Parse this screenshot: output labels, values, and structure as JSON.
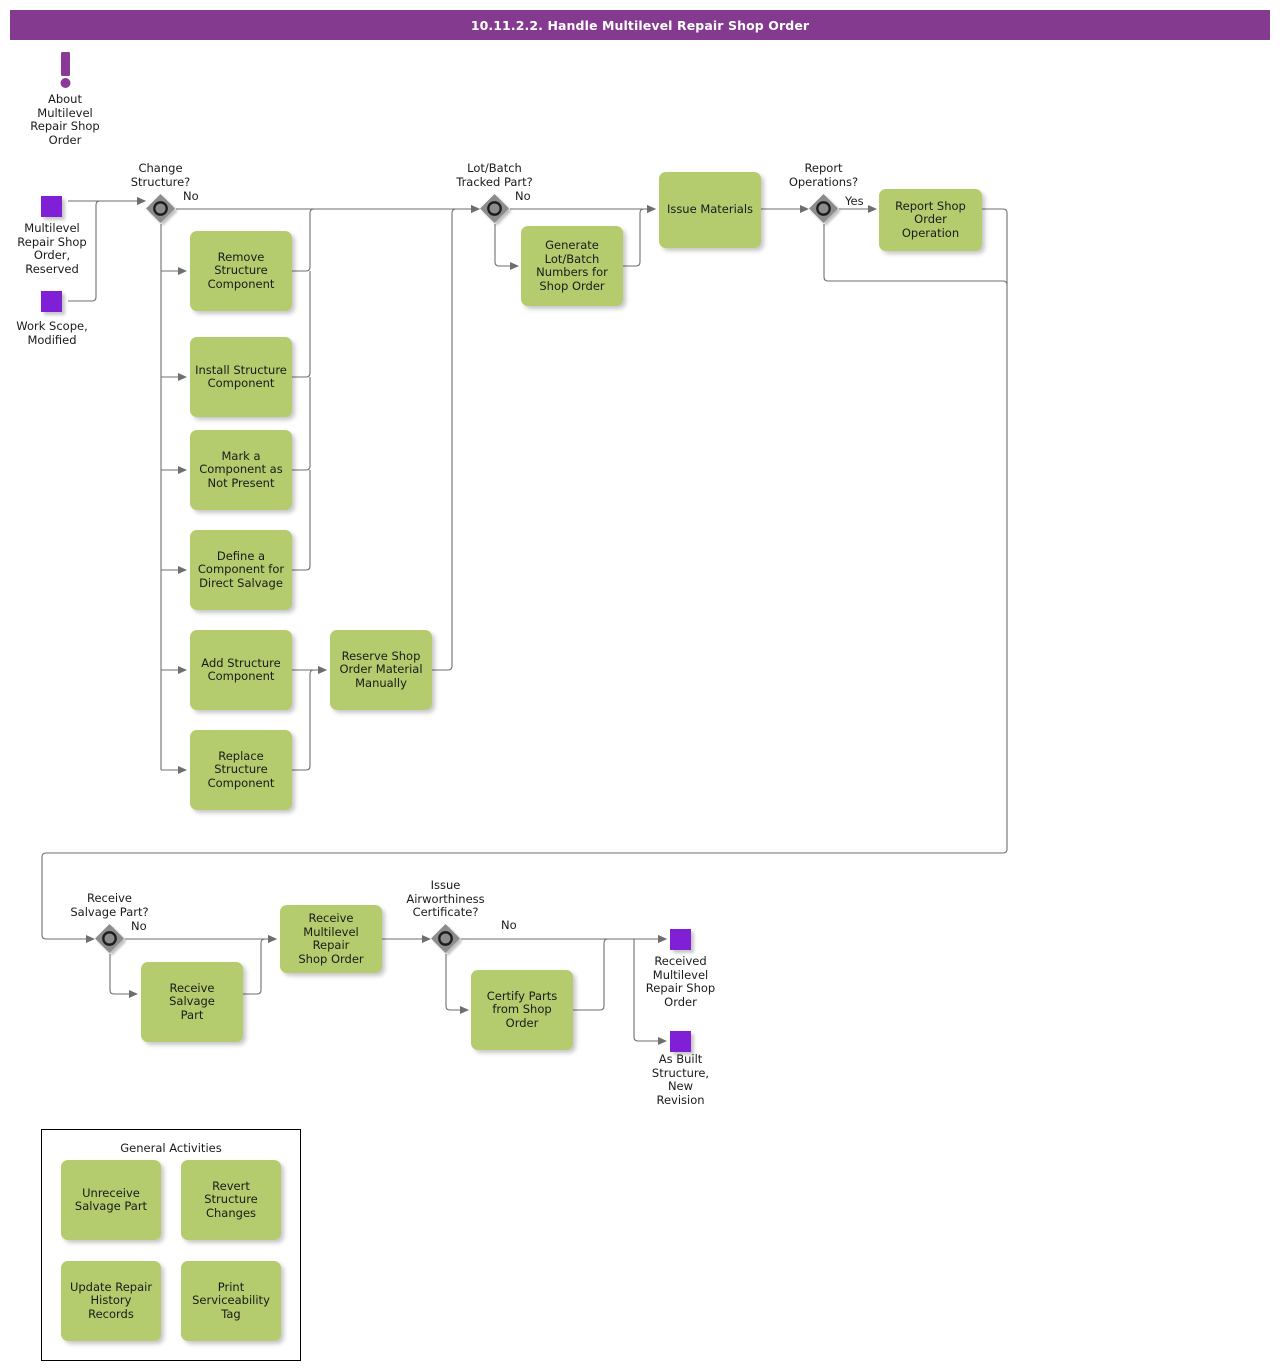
{
  "header": {
    "title": "10.11.2.2. Handle Multilevel Repair Shop Order"
  },
  "about": {
    "icon": "exclamation-mark-icon",
    "label": "About\nMultilevel\nRepair Shop\nOrder"
  },
  "start_nodes": [
    {
      "name": "multilevel-repair-shop-order-reserved",
      "label": "Multilevel\nRepair Shop\nOrder,\nReserved"
    },
    {
      "name": "work-scope-modified",
      "label": "Work Scope,\nModified"
    }
  ],
  "end_nodes": [
    {
      "name": "received-multilevel-repair-shop-order",
      "label": "Received\nMultilevel\nRepair Shop\nOrder"
    },
    {
      "name": "as-built-structure-new-revision",
      "label": "As Built\nStructure,\nNew\nRevision"
    }
  ],
  "gateways": [
    {
      "name": "change-structure",
      "label": "Change\nStructure?",
      "branch_label": "No"
    },
    {
      "name": "lot-batch-tracked-part",
      "label": "Lot/Batch\nTracked Part?",
      "branch_label": "No"
    },
    {
      "name": "report-operations",
      "label": "Report\nOperations?",
      "branch_label": "Yes"
    },
    {
      "name": "receive-salvage-part",
      "label": "Receive\nSalvage Part?",
      "branch_label": "No"
    },
    {
      "name": "issue-airworthiness-certificate",
      "label": "Issue\nAirworthiness\nCertificate?",
      "branch_label": "No"
    }
  ],
  "activities": [
    {
      "name": "remove-structure-component",
      "label": "Remove\nStructure\nComponent"
    },
    {
      "name": "install-structure-component",
      "label": "Install Structure\nComponent"
    },
    {
      "name": "mark-a-component-as-not-present",
      "label": "Mark a\nComponent as\nNot Present"
    },
    {
      "name": "define-a-component-for-direct-salvage",
      "label": "Define a\nComponent for\nDirect Salvage"
    },
    {
      "name": "add-structure-component",
      "label": "Add Structure\nComponent"
    },
    {
      "name": "replace-structure-component",
      "label": "Replace\nStructure\nComponent"
    },
    {
      "name": "reserve-shop-order-material-manually",
      "label": "Reserve Shop\nOrder Material\nManually"
    },
    {
      "name": "generate-lot-batch-numbers-for-shop-order",
      "label": "Generate\nLot/Batch\nNumbers for\nShop Order"
    },
    {
      "name": "issue-materials",
      "label": "Issue Materials"
    },
    {
      "name": "report-shop-order-operation",
      "label": "Report Shop\nOrder Operation"
    },
    {
      "name": "receive-salvage-part",
      "label": "Receive Salvage\nPart"
    },
    {
      "name": "receive-multilevel-repair-shop-order",
      "label": "Receive\nMultilevel Repair\nShop Order"
    },
    {
      "name": "certify-parts-from-shop-order",
      "label": "Certify Parts\nfrom Shop\nOrder"
    }
  ],
  "general_activities": {
    "title": "General Activities",
    "items": [
      {
        "name": "unreceive-salvage-part",
        "label": "Unreceive\nSalvage Part"
      },
      {
        "name": "revert-structure-changes",
        "label": "Revert Structure\nChanges"
      },
      {
        "name": "update-repair-history-records",
        "label": "Update Repair\nHistory Records"
      },
      {
        "name": "print-serviceability-tag",
        "label": "Print\nServiceability\nTag"
      }
    ]
  },
  "colors": {
    "title_bar": "#843B8F",
    "activity_fill": "#B4CC6D",
    "node_fill": "#7F1FD6",
    "gateway_fill": "#8C8C8C",
    "edge_stroke": "#666666",
    "text": "#1A1A1A"
  }
}
